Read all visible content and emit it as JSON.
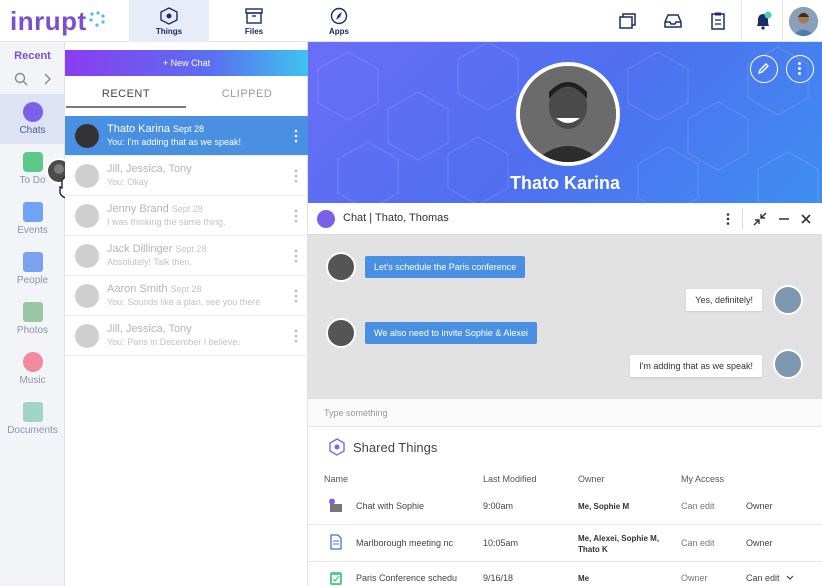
{
  "brand": {
    "logo_text": "inrupt",
    "accent": "#7b4fd0"
  },
  "topnav": {
    "tabs": [
      {
        "label": "Things",
        "icon": "hexagon-icon"
      },
      {
        "label": "Files",
        "icon": "archive-box-icon"
      },
      {
        "label": "Apps",
        "icon": "compass-icon"
      }
    ],
    "right_icons": [
      "windows-icon",
      "inbox-icon",
      "clipboard-icon",
      "bell-icon",
      "avatar"
    ]
  },
  "rail": {
    "recent_label": "Recent",
    "items": [
      {
        "label": "Chats",
        "icon": "chat-bubble-icon",
        "color": "#7b61e8"
      },
      {
        "label": "To Do",
        "icon": "checklist-icon",
        "color": "#5cc88a"
      },
      {
        "label": "Events",
        "icon": "calendar-icon",
        "color": "#6ea4f2"
      },
      {
        "label": "People",
        "icon": "contacts-icon",
        "color": "#7aa2f0"
      },
      {
        "label": "Photos",
        "icon": "photo-icon",
        "color": "#9bc6a4"
      },
      {
        "label": "Music",
        "icon": "headphones-icon",
        "color": "#f08a9c"
      },
      {
        "label": "Documents",
        "icon": "folder-icon",
        "color": "#9fd4c7"
      }
    ]
  },
  "chatlist": {
    "new_chat_label": "+ New Chat",
    "tabs": [
      "RECENT",
      "CLIPPED"
    ],
    "rows": [
      {
        "name": "Thato Karina",
        "date": "Sept 28",
        "preview": "You: I'm adding that as we speak!"
      },
      {
        "name": "Jill, Jessica, Tony",
        "date": "",
        "preview": "You: Okay"
      },
      {
        "name": "Jenny Brand",
        "date": "Sept 28",
        "preview": "I was thinking the same thing."
      },
      {
        "name": "Jack Dillinger",
        "date": "Sept 28",
        "preview": "Absolutely! Talk then."
      },
      {
        "name": "Aaron Smith",
        "date": "Sept 28",
        "preview": "You: Sounds like a plan, see you there"
      },
      {
        "name": "Jill, Jessica, Tony",
        "date": "",
        "preview": "You: Paris in December I believe."
      }
    ]
  },
  "profile": {
    "name": "Thato Karina"
  },
  "chat": {
    "title": "Chat | Thato, Thomas",
    "messages": [
      {
        "side": "in",
        "text": "Let's schedule the Paris conference"
      },
      {
        "side": "out",
        "text": "Yes, definitely!"
      },
      {
        "side": "in",
        "text": "We also need to invite Sophie & Alexei"
      },
      {
        "side": "out",
        "text": "I'm adding that as we speak!"
      }
    ],
    "input_placeholder": "Type something"
  },
  "shared": {
    "title": "Shared Things",
    "columns": [
      "Name",
      "Last Modified",
      "Owner",
      "My Access"
    ],
    "rows": [
      {
        "name": "Chat with Sophie",
        "modified": "9:00am",
        "owner": "Me, Sophie M",
        "access": "Can edit",
        "role": "Owner"
      },
      {
        "name": "Marlborough meeting nc",
        "modified": "10:05am",
        "owner": "Me, Alexei, Sophie M, Thato K",
        "access": "Can edit",
        "role": "Owner"
      },
      {
        "name": "Paris Conference schedu",
        "modified": "9/16/18",
        "owner": "Me",
        "access": "Owner",
        "role": "Can edit"
      }
    ]
  }
}
